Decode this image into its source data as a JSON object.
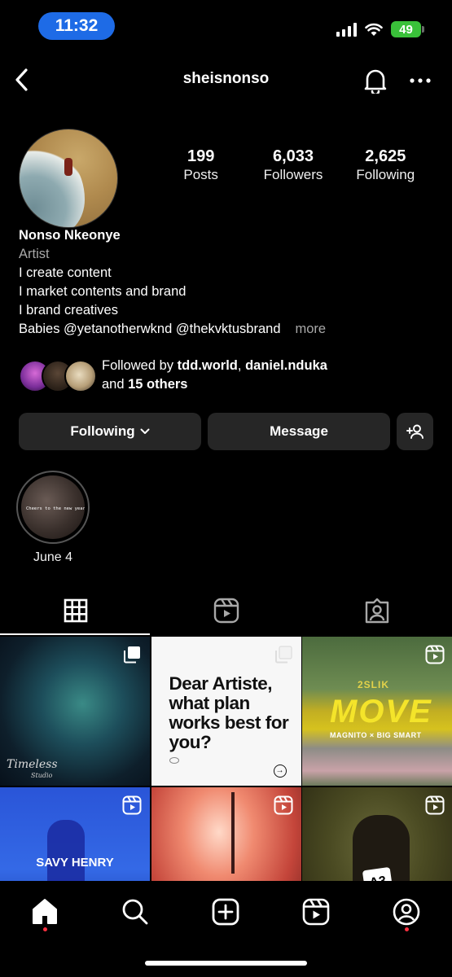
{
  "status_bar": {
    "time": "11:32",
    "battery": "49"
  },
  "header": {
    "username": "sheisnonso",
    "icons": {
      "back": "chevron-left-icon",
      "notifications": "bell-icon",
      "more": "more-horizontal-icon"
    }
  },
  "profile": {
    "stats": [
      {
        "value": "199",
        "label": "Posts"
      },
      {
        "value": "6,033",
        "label": "Followers"
      },
      {
        "value": "2,625",
        "label": "Following"
      }
    ],
    "name": "Nonso Nkeonye",
    "category": "Artist",
    "bio_lines": [
      "I create content",
      "I market contents and brand",
      "I brand creatives",
      "Babies @yetanotherwknd @thekvktusbrand"
    ],
    "more_label": "more",
    "followed_by": {
      "prefix": "Followed by",
      "user1": "tdd.world",
      "separator": ",",
      "user2": "daniel.nduka",
      "and": "and",
      "others": "15 others"
    }
  },
  "actions": {
    "following_label": "Following",
    "message_label": "Message"
  },
  "highlights": [
    {
      "label": "June 4",
      "cover_text": "Cheers to the new year"
    }
  ],
  "tabs": [
    {
      "name": "grid",
      "icon": "grid-icon",
      "active": true
    },
    {
      "name": "reels",
      "icon": "reels-icon",
      "active": false
    },
    {
      "name": "tagged",
      "icon": "tagged-icon",
      "active": false
    }
  ],
  "posts": {
    "post1": {
      "type": "carousel",
      "caption": "Timeless",
      "caption2": "Studio"
    },
    "post2": {
      "type": "carousel",
      "headline": "Dear Artiste, what plan works best for you?"
    },
    "post3": {
      "type": "reel",
      "artist": "2SLIK",
      "title": "MOVE",
      "credits": "MAGNITO × BIG SMART"
    },
    "post4": {
      "type": "reel",
      "caption": "SAVY HENRY"
    },
    "post5": {
      "type": "reel"
    },
    "post6": {
      "type": "reel",
      "logo": "A3"
    }
  },
  "bottom_nav": [
    "home-icon",
    "search-icon",
    "create-icon",
    "reels-icon",
    "profile-icon"
  ],
  "colors": {
    "accent_blue": "#1e6be6",
    "battery_green": "#3ac13a",
    "notification_red": "#ff3040",
    "button_bg": "#262626"
  }
}
